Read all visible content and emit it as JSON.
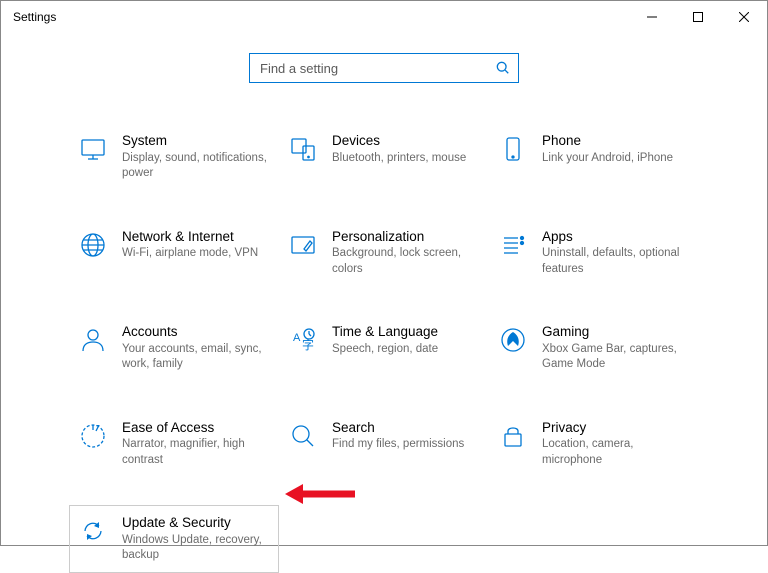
{
  "window": {
    "title": "Settings"
  },
  "search": {
    "placeholder": "Find a setting"
  },
  "tiles": {
    "system": {
      "title": "System",
      "desc": "Display, sound, notifications, power"
    },
    "devices": {
      "title": "Devices",
      "desc": "Bluetooth, printers, mouse"
    },
    "phone": {
      "title": "Phone",
      "desc": "Link your Android, iPhone"
    },
    "network": {
      "title": "Network & Internet",
      "desc": "Wi-Fi, airplane mode, VPN"
    },
    "personal": {
      "title": "Personalization",
      "desc": "Background, lock screen, colors"
    },
    "apps": {
      "title": "Apps",
      "desc": "Uninstall, defaults, optional features"
    },
    "accounts": {
      "title": "Accounts",
      "desc": "Your accounts, email, sync, work, family"
    },
    "time": {
      "title": "Time & Language",
      "desc": "Speech, region, date"
    },
    "gaming": {
      "title": "Gaming",
      "desc": "Xbox Game Bar, captures, Game Mode"
    },
    "ease": {
      "title": "Ease of Access",
      "desc": "Narrator, magnifier, high contrast"
    },
    "searchcat": {
      "title": "Search",
      "desc": "Find my files, permissions"
    },
    "privacy": {
      "title": "Privacy",
      "desc": "Location, camera, microphone"
    },
    "update": {
      "title": "Update & Security",
      "desc": "Windows Update, recovery, backup"
    }
  }
}
